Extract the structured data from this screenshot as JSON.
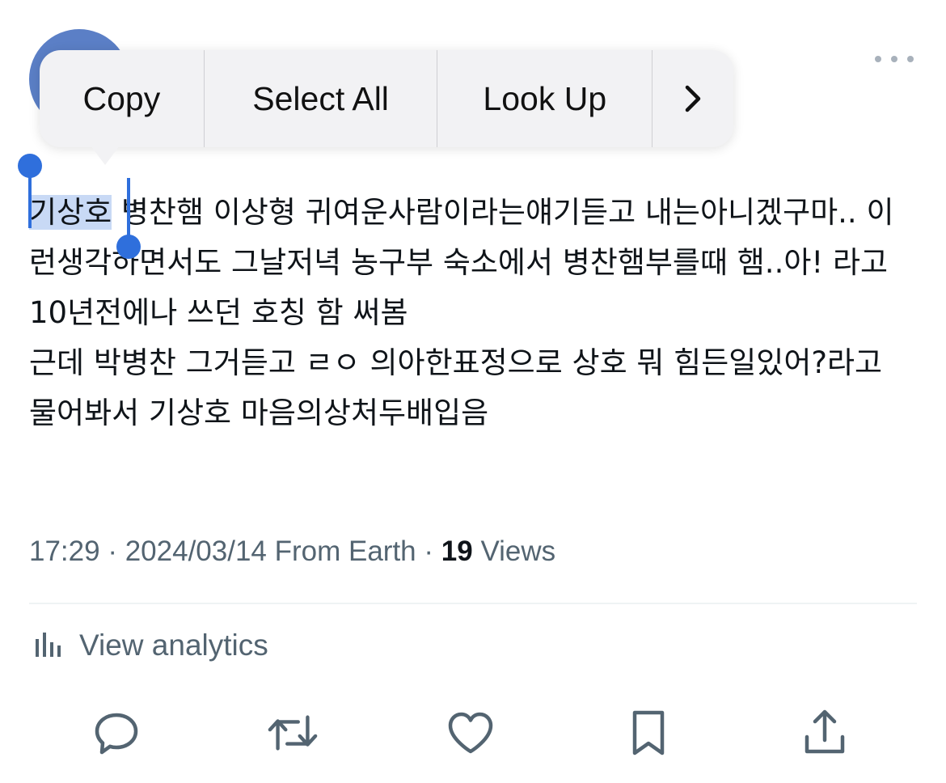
{
  "context_menu": {
    "items": [
      "Copy",
      "Select All",
      "Look Up"
    ],
    "more_icon": "chevron-right-icon"
  },
  "tweet": {
    "selected_text": "기상호",
    "text_after_selection": " 병찬햄 이상형 귀여운사람이라는얘기듣고 내는아니겠구마.. 이런생각하면서도 그날저녁 농구부 숙소에서 병찬햄부를때 햄..아! 라고 10년전에나 쓰던 호칭 함 써봄\n근데 박병찬 그거듣고 ㄹㅇ 의아한표정으로 상호 뭐 힘든일있어?라고 물어봐서 기상호 마음의상처두배입음"
  },
  "meta": {
    "time": "17:29",
    "separator": " · ",
    "date": "2024/03/14",
    "source": "From Earth",
    "views_count": "19",
    "views_label": "Views"
  },
  "analytics": {
    "label": "View analytics",
    "icon": "bar-chart-icon"
  },
  "actions": [
    "reply-icon",
    "retweet-icon",
    "like-icon",
    "bookmark-icon",
    "share-icon"
  ],
  "colors": {
    "selection": "#3a78dc",
    "secondary_text": "#536471",
    "primary_text": "#0f1419"
  }
}
